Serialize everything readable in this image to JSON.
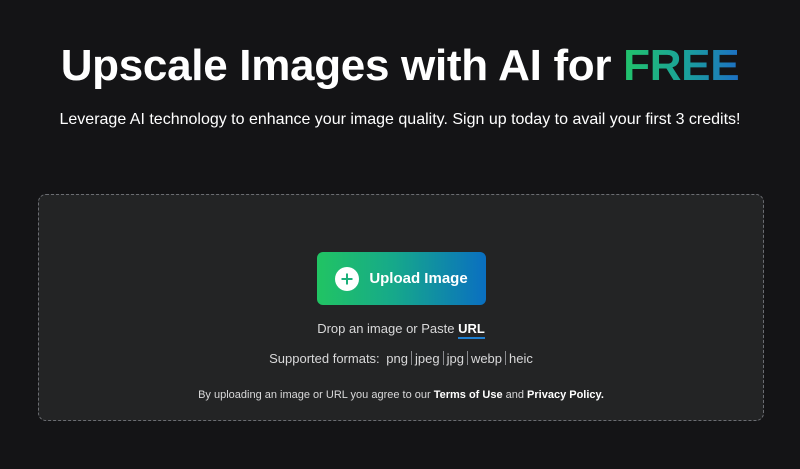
{
  "hero": {
    "title_main": "Upscale Images with AI for ",
    "title_highlight": "FREE",
    "subtitle": "Leverage AI technology to enhance your image quality. Sign up today to avail your first 3 credits!"
  },
  "dropzone": {
    "upload_button_label": "Upload Image",
    "upload_icon": "plus-circle-icon",
    "drop_text": "Drop an image or Paste ",
    "url_link": "URL",
    "formats_label": "Supported formats:",
    "formats": [
      "png",
      "jpeg",
      "jpg",
      "webp",
      "heic"
    ],
    "legal_prefix": "By uploading an image or URL you agree to our ",
    "terms_link": "Terms of Use",
    "legal_and": " and ",
    "privacy_link": "Privacy Policy."
  },
  "colors": {
    "background": "#141416",
    "dropzone_background": "#232425",
    "gradient_start": "#21c463",
    "gradient_end": "#0a6fc1",
    "link_underline": "#1e7fd0"
  }
}
